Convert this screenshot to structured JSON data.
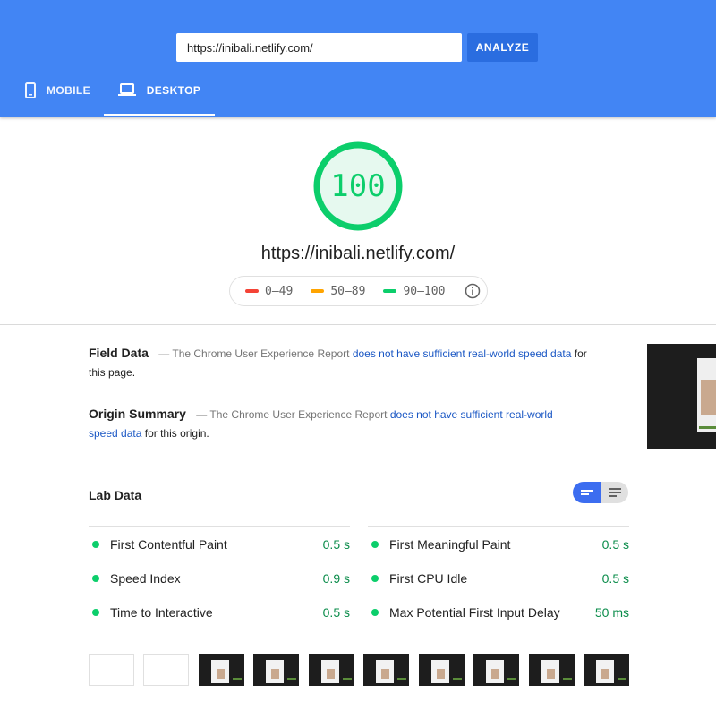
{
  "search": {
    "url_value": "https://inibali.netlify.com/",
    "analyze_label": "ANALYZE"
  },
  "tabs": [
    {
      "label": "MOBILE",
      "icon": "phone-icon",
      "selected": false
    },
    {
      "label": "DESKTOP",
      "icon": "laptop-icon",
      "selected": true
    }
  ],
  "report": {
    "score": "100",
    "tested_url": "https://inibali.netlify.com/",
    "legend": [
      {
        "range": "0–49",
        "color": "#f44336"
      },
      {
        "range": "50–89",
        "color": "#ffa400"
      },
      {
        "range": "90–100",
        "color": "#0cce6b"
      }
    ]
  },
  "field_data": {
    "title": "Field Data",
    "dash": "—",
    "prefix": "The Chrome User Experience Report",
    "link": "does not have sufficient real-world speed data",
    "suffix": "for this page."
  },
  "origin_summary": {
    "title": "Origin Summary",
    "dash": "—",
    "prefix": "The Chrome User Experience Report",
    "link": "does not have sufficient real-world speed data",
    "suffix": "for this origin."
  },
  "lab_data": {
    "title": "Lab Data",
    "metrics": [
      {
        "name": "First Contentful Paint",
        "value": "0.5 s"
      },
      {
        "name": "First Meaningful Paint",
        "value": "0.5 s"
      },
      {
        "name": "Speed Index",
        "value": "0.9 s"
      },
      {
        "name": "First CPU Idle",
        "value": "0.5 s"
      },
      {
        "name": "Time to Interactive",
        "value": "0.5 s"
      },
      {
        "name": "Max Potential First Input Delay",
        "value": "50 ms"
      }
    ]
  },
  "colors": {
    "header": "#4285f4",
    "pass": "#0cce6b",
    "link": "#1a57c4"
  }
}
